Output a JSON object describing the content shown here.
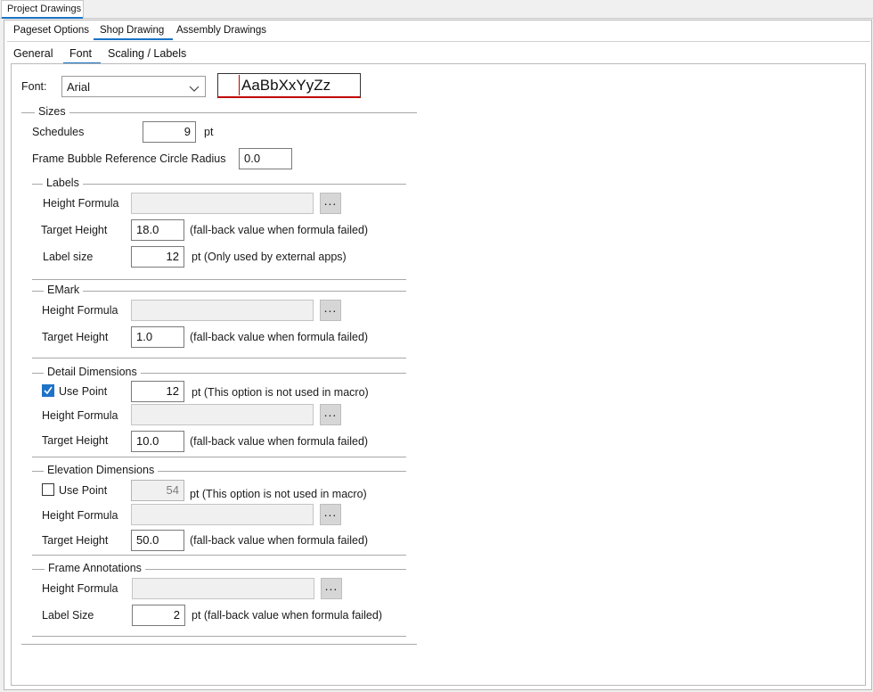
{
  "tabs": {
    "top": "Project Drawings",
    "level2": [
      "Pageset Options",
      "Shop Drawing",
      "Assembly Drawings"
    ],
    "level3": [
      "General",
      "Font",
      "Scaling / Labels"
    ]
  },
  "font": {
    "label": "Font:",
    "selected": "Arial",
    "preview": "AaBbXxYyZz"
  },
  "sizes": {
    "header": "Sizes",
    "schedules_label": "Schedules",
    "schedules_value": "9",
    "schedules_unit": "pt",
    "frame_bubble_label": "Frame Bubble Reference Circle Radius",
    "frame_bubble_value": "0.0"
  },
  "labels": {
    "header": "Labels",
    "height_formula_label": "Height Formula",
    "browse": "...",
    "target_height_label": "Target Height",
    "target_height_value": "18.0",
    "target_height_note": "(fall-back value when formula failed)",
    "label_size_label": "Label size",
    "label_size_value": "12",
    "label_size_note": "pt  (Only used by external apps)"
  },
  "emark": {
    "header": "EMark",
    "height_formula_label": "Height Formula",
    "browse": "...",
    "target_height_label": "Target Height",
    "target_height_value": "1.0",
    "target_height_note": "(fall-back value when formula failed)"
  },
  "detail": {
    "header": "Detail Dimensions",
    "use_point_label": "Use Point",
    "use_point_checked": true,
    "use_point_value": "12",
    "use_point_note": "pt (This option is not used in macro)",
    "height_formula_label": "Height Formula",
    "browse": "...",
    "target_height_label": "Target Height",
    "target_height_value": "10.0",
    "target_height_note": "(fall-back value when formula failed)"
  },
  "elevation": {
    "header": "Elevation Dimensions",
    "use_point_label": "Use Point",
    "use_point_checked": false,
    "use_point_value": "54",
    "use_point_note": "pt (This option is not used in macro)",
    "height_formula_label": "Height Formula",
    "browse": "...",
    "target_height_label": "Target Height",
    "target_height_value": "50.0",
    "target_height_note": "(fall-back value when formula failed)"
  },
  "frame": {
    "header": "Frame Annotations",
    "height_formula_label": "Height Formula",
    "browse": "...",
    "label_size_label": "Label Size",
    "label_size_value": "2",
    "label_size_note": "pt (fall-back value when formula failed)"
  },
  "colors": {
    "accent": "#1a73c4",
    "checkbox": "#1e73c8",
    "preview_border_red": "#c00000"
  }
}
